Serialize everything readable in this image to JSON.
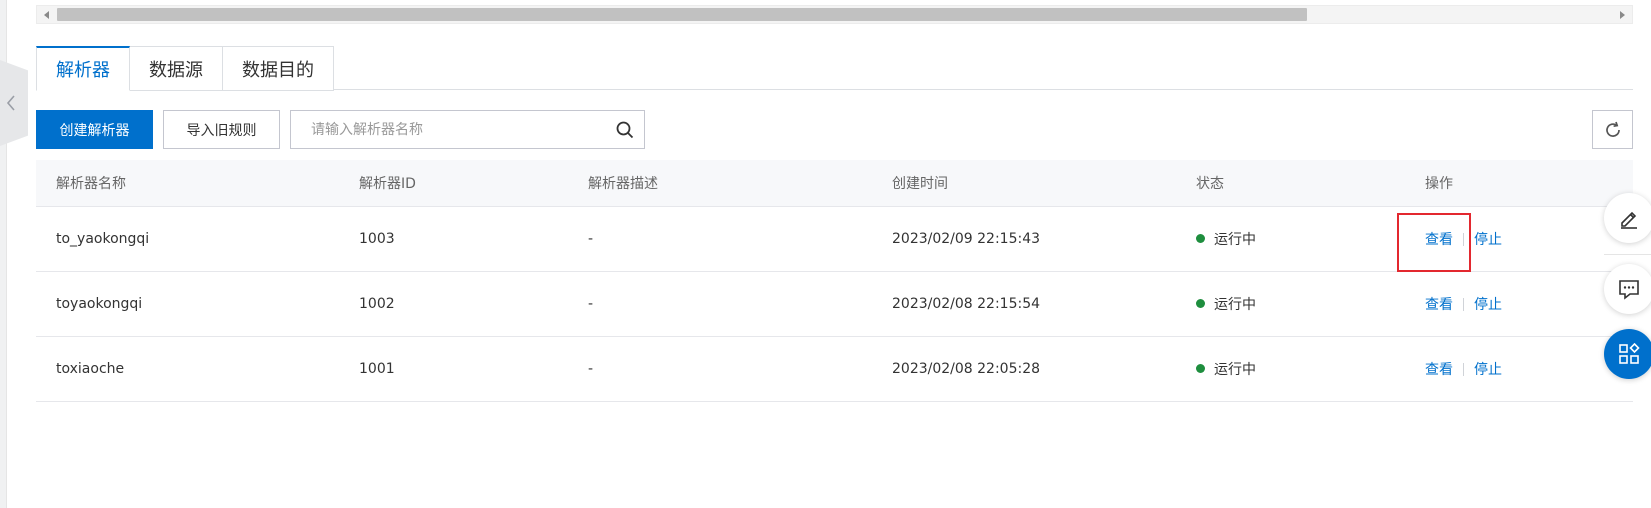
{
  "tabs": [
    {
      "label": "解析器"
    },
    {
      "label": "数据源"
    },
    {
      "label": "数据目的"
    }
  ],
  "toolbar": {
    "create_label": "创建解析器",
    "import_label": "导入旧规则",
    "search_placeholder": "请输入解析器名称"
  },
  "table": {
    "headers": [
      "解析器名称",
      "解析器ID",
      "解析器描述",
      "创建时间",
      "状态",
      "操作"
    ],
    "rows": [
      {
        "name": "to_yaokongqi",
        "id": "1003",
        "desc": "-",
        "created": "2023/02/09 22:15:43",
        "status": "运行中",
        "view": "查看",
        "stop": "停止"
      },
      {
        "name": "toyaokongqi",
        "id": "1002",
        "desc": "-",
        "created": "2023/02/08 22:15:54",
        "status": "运行中",
        "view": "查看",
        "stop": "停止"
      },
      {
        "name": "toxiaoche",
        "id": "1001",
        "desc": "-",
        "created": "2023/02/08 22:05:28",
        "status": "运行中",
        "view": "查看",
        "stop": "停止"
      }
    ]
  },
  "icons": {
    "search": "search-icon",
    "refresh": "refresh-icon",
    "edit": "edit-icon",
    "chat": "chat-icon",
    "apps": "apps-icon",
    "collapse": "chevron-left-icon"
  },
  "colors": {
    "primary": "#0070cc",
    "status_running": "#1e8e3e",
    "highlight": "#e3282f"
  }
}
